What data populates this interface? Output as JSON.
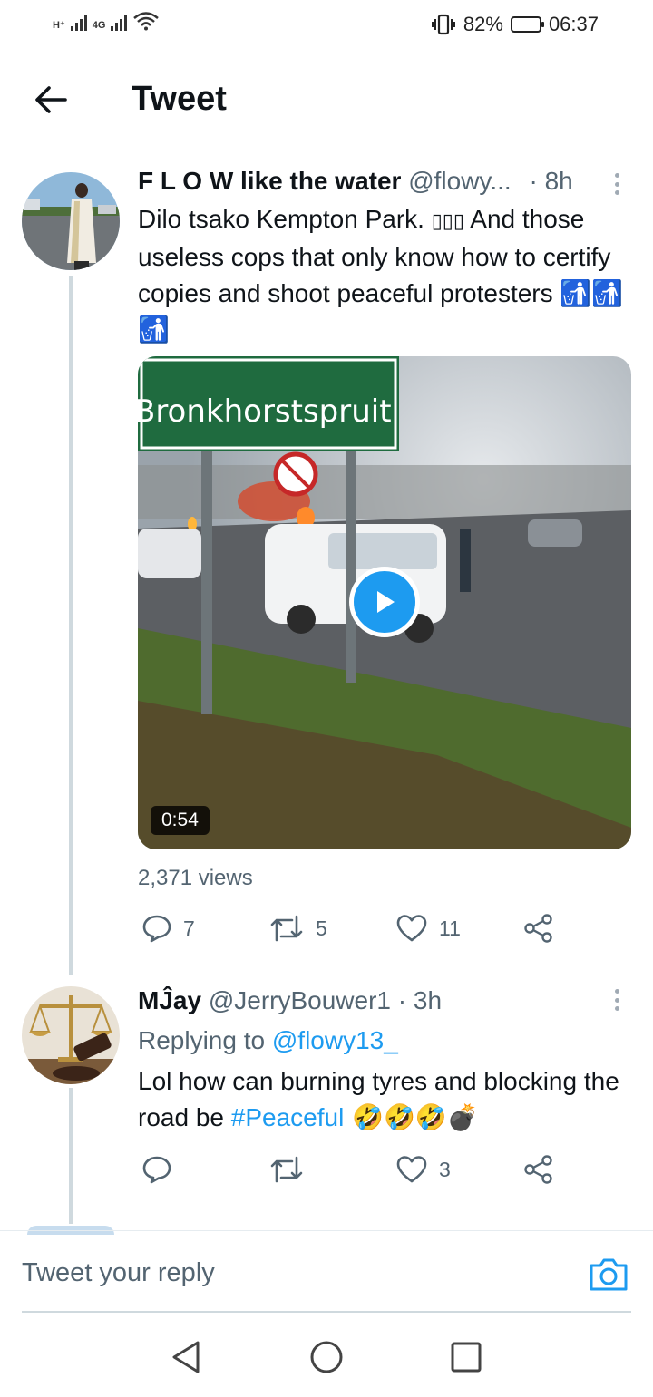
{
  "status_bar": {
    "network_1": "H⁺",
    "network_2": "4G",
    "battery_percent": "82%",
    "battery_level": 0.82,
    "time": "06:37"
  },
  "header": {
    "title": "Tweet"
  },
  "tweets": [
    {
      "display_name": "F L O W like the water",
      "handle": "@flowy...",
      "time": "· 8h",
      "text_before_emoji": "Dilo tsako Kempton Park. ",
      "emoji_placeholder": "▯▯▯",
      "text_after_emoji": " And those useless cops that only know how to certify copies and shoot peaceful protesters ",
      "trailing_emoji": "🚮🚮🚮",
      "media": {
        "sign_text": "Bronkhorstspruit",
        "duration": "0:54"
      },
      "views": "2,371 views",
      "reply_count": "7",
      "retweet_count": "5",
      "like_count": "11"
    },
    {
      "display_name": "MĴay",
      "handle": "@JerryBouwer1",
      "time": "· 3h",
      "replying_prefix": "Replying to ",
      "replying_handle": "@flowy13_",
      "text_before_hashtag": "Lol how can burning tyres and blocking the road be ",
      "hashtag": "#Peaceful",
      "trailing_emoji": " 🤣🤣🤣💣",
      "reply_count": "",
      "retweet_count": "",
      "like_count": "3"
    }
  ],
  "reply_bar": {
    "placeholder": "Tweet your reply"
  },
  "colors": {
    "accent": "#1d9bf0",
    "muted_text": "#536471",
    "divider": "#e6ecf0"
  },
  "icons": {
    "back": "arrow-left-icon",
    "reply": "speech-bubble-icon",
    "retweet": "retweet-icon",
    "like": "heart-icon",
    "share": "share-icon",
    "camera": "camera-icon"
  }
}
